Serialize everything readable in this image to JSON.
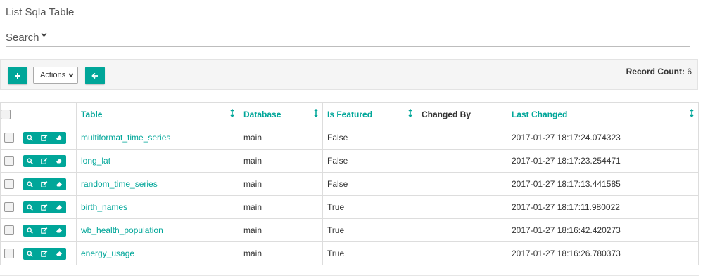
{
  "page": {
    "title": "List Sqla Table",
    "search_label": "Search"
  },
  "toolbar": {
    "add_label": "+",
    "actions_label": "Actions",
    "record_count_label": "Record Count:",
    "record_count_value": "6"
  },
  "colors": {
    "accent": "#00a699"
  },
  "columns": {
    "table": "Table",
    "database": "Database",
    "is_featured": "Is Featured",
    "changed_by": "Changed By",
    "last_changed": "Last Changed"
  },
  "rows": [
    {
      "table": "multiformat_time_series",
      "database": "main",
      "is_featured": "False",
      "changed_by": "",
      "last_changed": "2017-01-27 18:17:24.074323"
    },
    {
      "table": "long_lat",
      "database": "main",
      "is_featured": "False",
      "changed_by": "",
      "last_changed": "2017-01-27 18:17:23.254471"
    },
    {
      "table": "random_time_series",
      "database": "main",
      "is_featured": "False",
      "changed_by": "",
      "last_changed": "2017-01-27 18:17:13.441585"
    },
    {
      "table": "birth_names",
      "database": "main",
      "is_featured": "True",
      "changed_by": "",
      "last_changed": "2017-01-27 18:17:11.980022"
    },
    {
      "table": "wb_health_population",
      "database": "main",
      "is_featured": "True",
      "changed_by": "",
      "last_changed": "2017-01-27 18:16:42.420273"
    },
    {
      "table": "energy_usage",
      "database": "main",
      "is_featured": "True",
      "changed_by": "",
      "last_changed": "2017-01-27 18:16:26.780373"
    }
  ],
  "icons": [
    "chevron-down-icon",
    "plus-icon",
    "arrow-left-icon",
    "sort-icon",
    "search-icon",
    "edit-icon",
    "eraser-icon"
  ]
}
